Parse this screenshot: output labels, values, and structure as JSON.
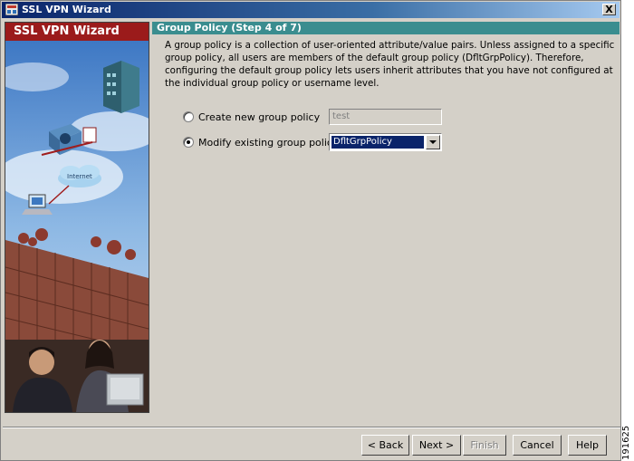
{
  "window": {
    "title": "SSL VPN Wizard",
    "close_label": "X"
  },
  "sidebar": {
    "title": "SSL VPN Wizard"
  },
  "step": {
    "title": "Group Policy    (Step 4 of 7)",
    "description": "A group policy is a collection of user-oriented attribute/value pairs. Unless assigned to a specific group policy, all users are members of the default group policy (DfltGrpPolicy). Therefore, configuring the default group policy lets users inherit attributes that you have not configured at the individual group policy or username level."
  },
  "options": {
    "create_label": "Create new group policy",
    "create_value": "test",
    "modify_label": "Modify existing group policy",
    "modify_value": "DfltGrpPolicy",
    "selected": "modify"
  },
  "buttons": {
    "back": "< Back",
    "next": "Next >",
    "finish": "Finish",
    "cancel": "Cancel",
    "help": "Help"
  },
  "figure_id": "191625",
  "colors": {
    "title_bar": "#0a246a",
    "sidebar_header": "#9b1b1b",
    "step_header": "#3a8d8f",
    "selection": "#0a246a"
  }
}
